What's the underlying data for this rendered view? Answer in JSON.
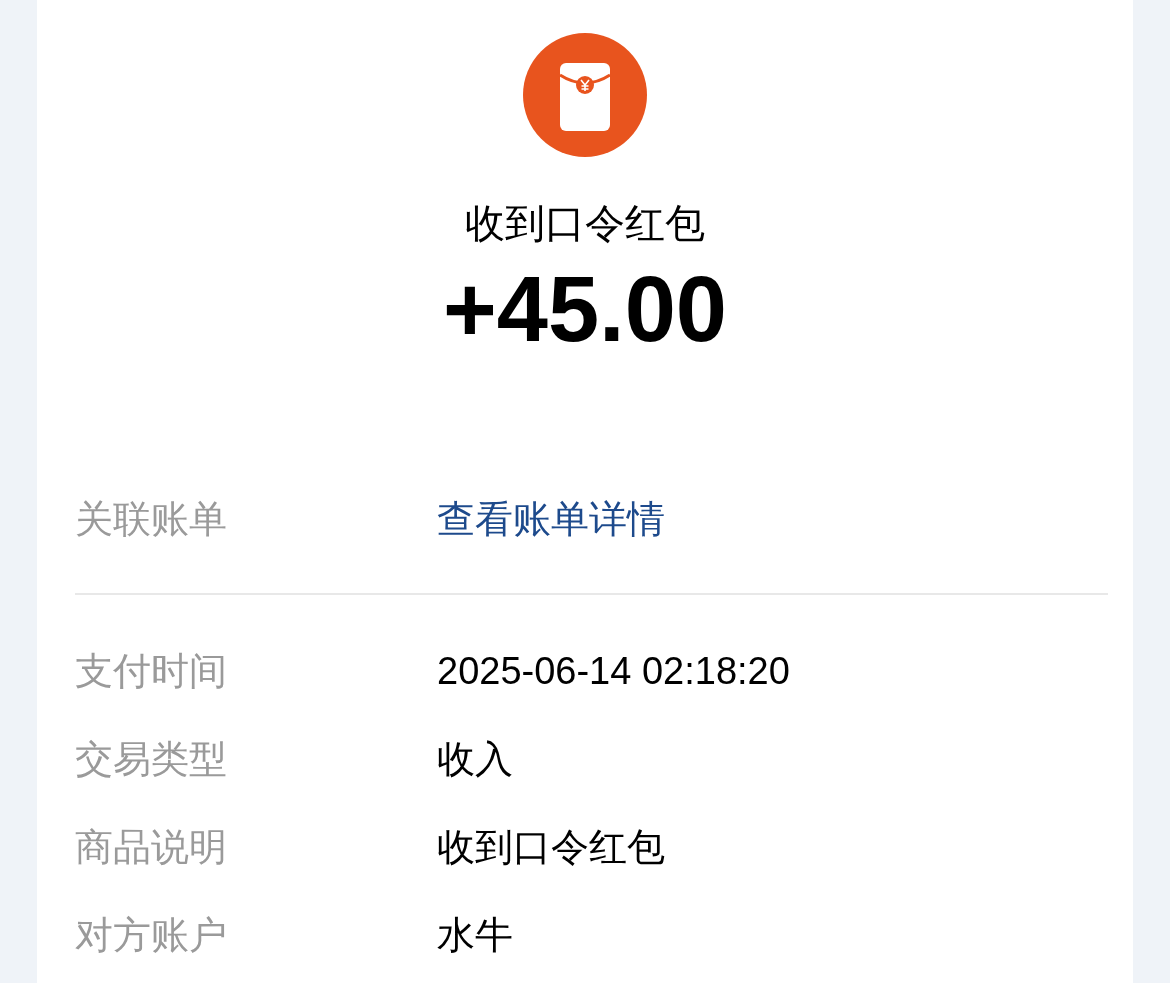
{
  "header": {
    "title": "收到口令红包",
    "amount": "+45.00"
  },
  "linked": {
    "label": "关联账单",
    "value": "查看账单详情"
  },
  "details": [
    {
      "label": "支付时间",
      "value": "2025-06-14 02:18:20"
    },
    {
      "label": "交易类型",
      "value": "收入"
    },
    {
      "label": "商品说明",
      "value": "收到口令红包"
    },
    {
      "label": "对方账户",
      "value": "水牛"
    }
  ]
}
